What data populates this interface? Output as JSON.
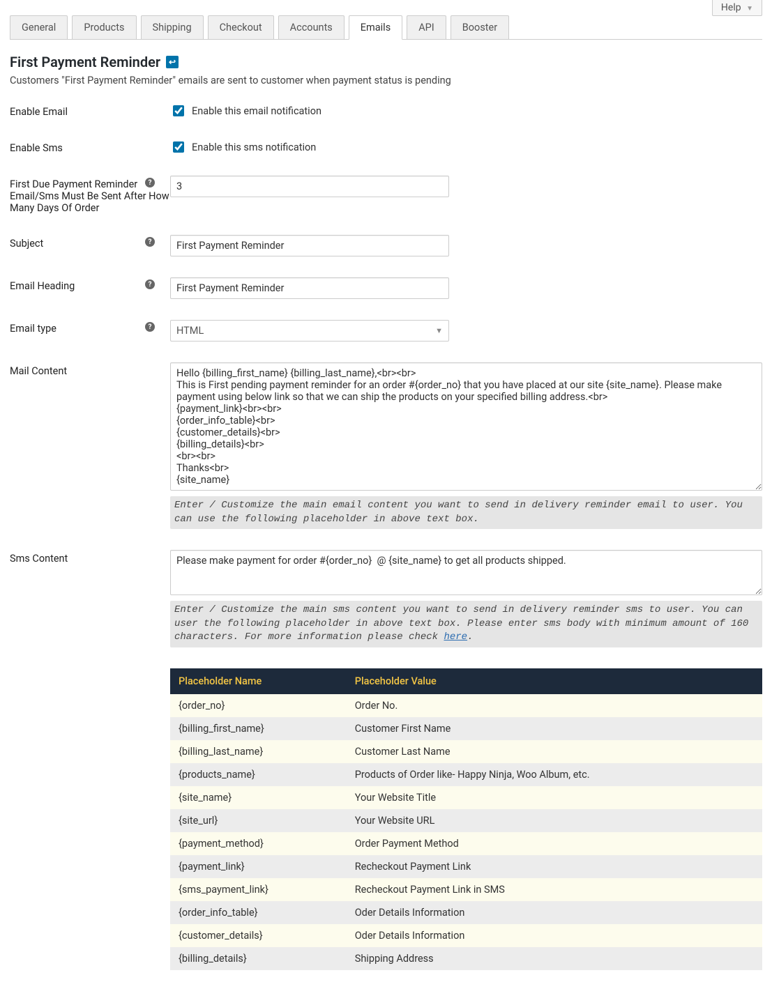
{
  "help_label": "Help",
  "tabs": [
    {
      "label": "General",
      "active": false
    },
    {
      "label": "Products",
      "active": false
    },
    {
      "label": "Shipping",
      "active": false
    },
    {
      "label": "Checkout",
      "active": false
    },
    {
      "label": "Accounts",
      "active": false
    },
    {
      "label": "Emails",
      "active": true
    },
    {
      "label": "API",
      "active": false
    },
    {
      "label": "Booster",
      "active": false
    }
  ],
  "page_title": "First Payment Reminder",
  "page_desc": "Customers \"First Payment Reminder\" emails are sent to customer when payment status is pending",
  "fields": {
    "enable_email_label": "Enable Email",
    "enable_email_text": "Enable this email notification",
    "enable_email_checked": true,
    "enable_sms_label": "Enable Sms",
    "enable_sms_text": "Enable this sms notification",
    "enable_sms_checked": true,
    "days_label": "First Due Payment Reminder Email/Sms Must Be Sent After How Many Days Of Order",
    "days_value": "3",
    "subject_label": "Subject",
    "subject_value": "First Payment Reminder",
    "heading_label": "Email Heading",
    "heading_value": "First Payment Reminder",
    "emailtype_label": "Email type",
    "emailtype_value": "HTML",
    "mailcontent_label": "Mail Content",
    "mailcontent_value": "Hello {billing_first_name} {billing_last_name},<br><br>\nThis is First pending payment reminder for an order #{order_no} that you have placed at our site {site_name}. Please make payment using below link so that we can ship the products on your specified billing address.<br>\n{payment_link}<br><br>\n{order_info_table}<br>\n{customer_details}<br>\n{billing_details}<br>\n<br><br>\nThanks<br>\n{site_name}",
    "mailcontent_hint": "Enter / Customize the main email content you want to send in delivery reminder email to user. You can use the following placeholder in above text box.",
    "smscontent_label": "Sms Content",
    "smscontent_value": "Please make payment for order #{order_no}  @ {site_name} to get all products shipped.",
    "smscontent_hint_pre": "Enter / Customize the main sms content you want to send in delivery reminder sms to user. You can user the following placeholder in above text box. Please enter sms body with minimum amount of 160 characters. For more information please check ",
    "smscontent_hint_link": "here",
    "smscontent_hint_post": "."
  },
  "placeholder_table": {
    "head": [
      "Placeholder Name",
      "Placeholder Value"
    ],
    "rows": [
      [
        "{order_no}",
        "Order No."
      ],
      [
        "{billing_first_name}",
        "Customer First Name"
      ],
      [
        "{billing_last_name}",
        "Customer Last Name"
      ],
      [
        "{products_name}",
        "Products of Order like- Happy Ninja, Woo Album, etc."
      ],
      [
        "{site_name}",
        "Your Website Title"
      ],
      [
        "{site_url}",
        "Your Website URL"
      ],
      [
        "{payment_method}",
        "Order Payment Method"
      ],
      [
        "{payment_link}",
        "Recheckout Payment Link"
      ],
      [
        "{sms_payment_link}",
        "Recheckout Payment Link in SMS"
      ],
      [
        "{order_info_table}",
        "Oder Details Information"
      ],
      [
        "{customer_details}",
        "Oder Details Information"
      ],
      [
        "{billing_details}",
        "Shipping Address"
      ]
    ]
  }
}
